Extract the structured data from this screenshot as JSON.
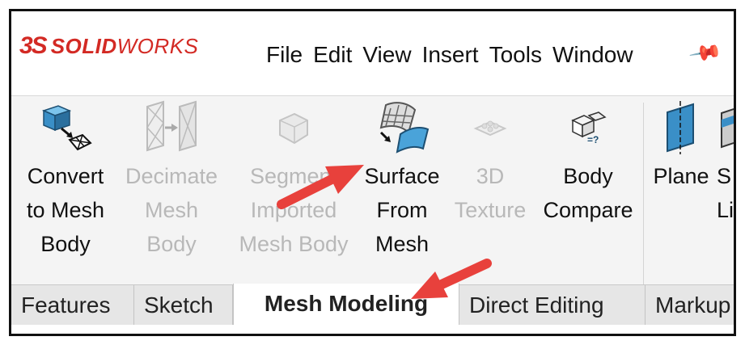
{
  "app": {
    "logo_mark": "3S",
    "logo_solid": "SOLID",
    "logo_works": "WORKS",
    "menu": [
      "File",
      "Edit",
      "View",
      "Insert",
      "Tools",
      "Window"
    ],
    "pin_icon": "pin-icon"
  },
  "ribbon": {
    "tools": [
      {
        "label": "Convert\nto Mesh\nBody",
        "enabled": true,
        "icon": "convert-to-mesh-icon"
      },
      {
        "label": "Decimate\nMesh\nBody",
        "enabled": false,
        "icon": "decimate-mesh-icon"
      },
      {
        "label": "Segment\nImported\nMesh Body",
        "enabled": false,
        "icon": "segment-mesh-icon"
      },
      {
        "label": "Surface\nFrom\nMesh",
        "enabled": true,
        "icon": "surface-from-mesh-icon"
      },
      {
        "label": "3D\nTexture",
        "enabled": false,
        "icon": "3d-texture-icon"
      },
      {
        "label": "Body\nCompare",
        "enabled": true,
        "icon": "body-compare-icon"
      },
      {
        "label": "Plane",
        "enabled": true,
        "icon": "plane-icon"
      },
      {
        "label": "S\nLi",
        "enabled": true,
        "icon": "partial-tool-icon"
      }
    ]
  },
  "tabs": [
    {
      "label": "Features",
      "active": false
    },
    {
      "label": "Sketch",
      "active": false
    },
    {
      "label": "Mesh Modeling",
      "active": true
    },
    {
      "label": "Direct Editing",
      "active": false
    },
    {
      "label": "Markup",
      "active": false
    }
  ],
  "colors": {
    "brand_red": "#d32a24",
    "annotation_arrow": "#e8413c",
    "icon_blue": "#3a8fc7"
  }
}
